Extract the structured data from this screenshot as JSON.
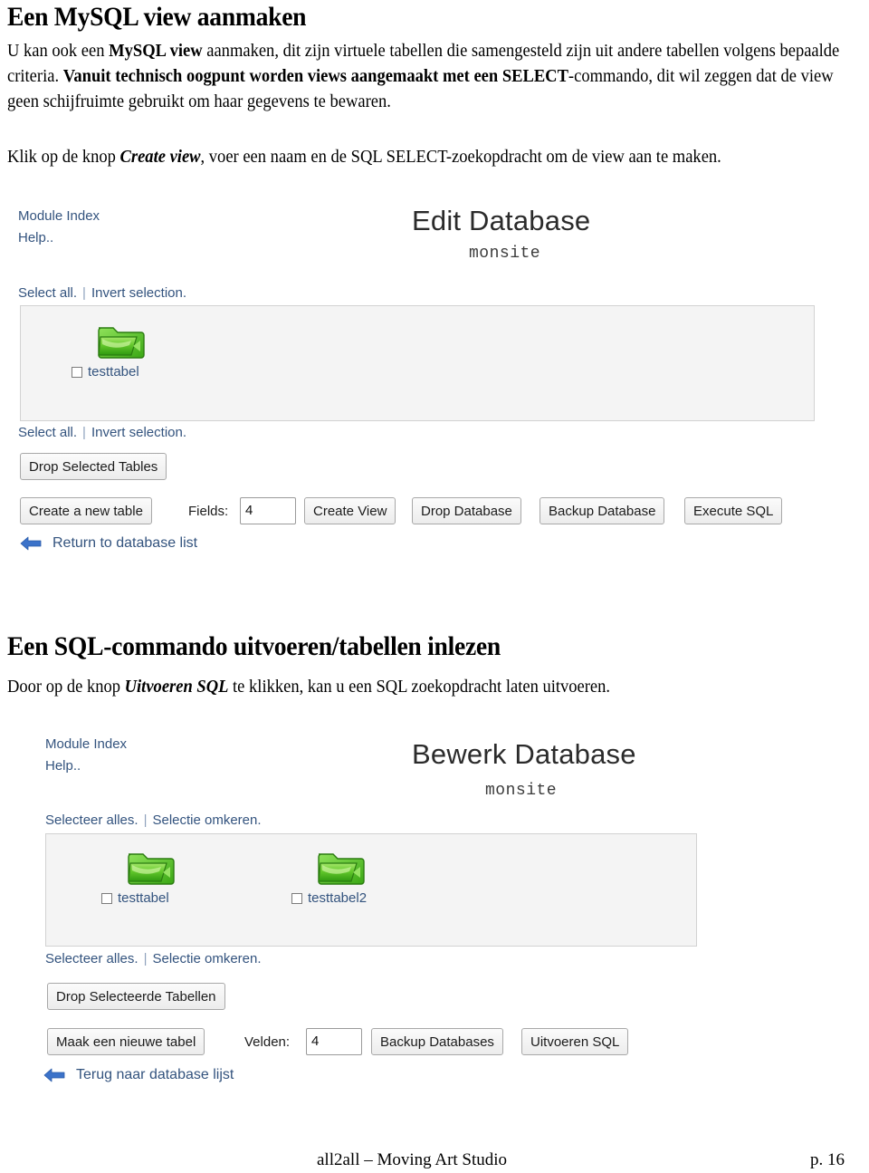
{
  "document": {
    "section1": {
      "heading": "Een MySQL view aanmaken",
      "para1_parts": [
        {
          "t": "U kan ook een ",
          "s": "n"
        },
        {
          "t": "MySQL view",
          "s": "b"
        },
        {
          "t": " aanmaken, dit zijn virtuele tabellen die samengesteld zijn uit andere tabellen volgens bepaalde criteria. ",
          "s": "n"
        },
        {
          "t": "Vanuit technisch oogpunt worden views aangemaakt met een ",
          "s": "b"
        },
        {
          "t": "SELECT",
          "s": "b"
        },
        {
          "t": "-commando, dit wil zeggen dat de view geen schijfruimte gebruikt om haar gegevens te bewaren.",
          "s": "n"
        }
      ],
      "para2_parts": [
        {
          "t": "Klik op de knop ",
          "s": "n"
        },
        {
          "t": "Create view",
          "s": "bi"
        },
        {
          "t": ", voer een naam en de SQL SELECT-zoekopdracht om de view aan te maken.",
          "s": "n"
        }
      ]
    },
    "section2": {
      "heading": "Een SQL-commando uitvoeren/tabellen inlezen",
      "para1_parts": [
        {
          "t": "Door op de knop ",
          "s": "n"
        },
        {
          "t": "Uitvoeren SQL",
          "s": "bi"
        },
        {
          "t": " te klikken, kan u een SQL zoekopdracht laten uitvoeren.",
          "s": "n"
        }
      ]
    },
    "footer": {
      "center": "all2all – Moving Art Studio",
      "page": "p. 16"
    }
  },
  "screenshot_en": {
    "nav": {
      "module_index": "Module Index",
      "help": "Help.."
    },
    "title": "Edit Database",
    "subtitle": "monsite",
    "select_bar_top": {
      "select_all": "Select all.",
      "separator": "|",
      "invert": "Invert selection."
    },
    "select_bar_bottom": {
      "select_all": "Select all.",
      "separator": "|",
      "invert": "Invert selection."
    },
    "tables": [
      {
        "name": "testtabel",
        "checked": false
      }
    ],
    "drop_selected_button": "Drop Selected Tables",
    "create_table_button": "Create a new table",
    "fields_label": "Fields:",
    "fields_value": "4",
    "create_view_button": "Create View",
    "drop_database_button": "Drop Database",
    "backup_database_button": "Backup Database",
    "execute_sql_button": "Execute SQL",
    "return_link": "Return to database list",
    "colors": {
      "link": "#33537e",
      "panel_bg": "#f4f4f4",
      "panel_border": "#d2d2d2",
      "arrow": "#2e63b8",
      "folder": "#5cc32a"
    }
  },
  "screenshot_nl": {
    "nav": {
      "module_index": "Module Index",
      "help": "Help.."
    },
    "title": "Bewerk Database",
    "subtitle": "monsite",
    "select_bar_top": {
      "select_all": "Selecteer alles.",
      "separator": "|",
      "invert": "Selectie omkeren."
    },
    "select_bar_bottom": {
      "select_all": "Selecteer alles.",
      "separator": "|",
      "invert": "Selectie omkeren."
    },
    "tables": [
      {
        "name": "testtabel",
        "checked": false
      },
      {
        "name": "testtabel2",
        "checked": false
      }
    ],
    "drop_selected_button": "Drop Selecteerde Tabellen",
    "create_table_button": "Maak een nieuwe tabel",
    "fields_label": "Velden:",
    "fields_value": "4",
    "backup_database_button": "Backup Databases",
    "execute_sql_button": "Uitvoeren SQL",
    "return_link": "Terug naar database lijst"
  }
}
